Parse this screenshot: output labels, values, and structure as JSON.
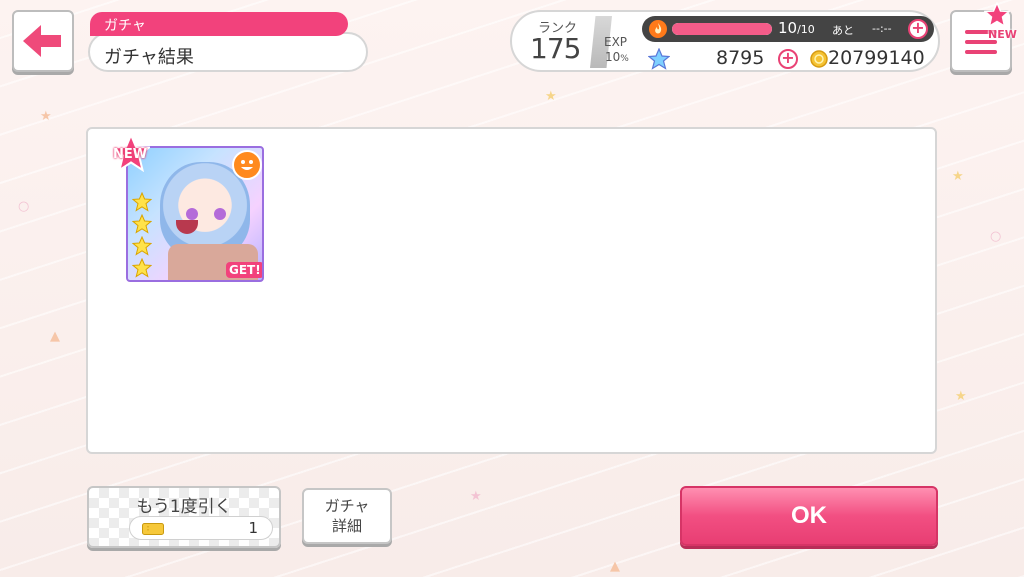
{
  "header": {
    "back_icon": "arrow-left-icon",
    "section_tab": "ガチャ",
    "page_title": "ガチャ結果"
  },
  "status": {
    "rank_label": "ランク",
    "rank_value": "175",
    "exp_label": "EXP",
    "exp_percent": "10",
    "exp_percent_unit": "%",
    "stamina_current": "10",
    "stamina_max": "/10",
    "stamina_refill_label": "あと",
    "stamina_timer": "--:--",
    "star_gems": "8795",
    "coins": "20799140"
  },
  "menu": {
    "menu_icon": "hamburger-menu-icon",
    "new_badge": "NEW"
  },
  "result": {
    "cards": [
      {
        "new_badge": "NEW",
        "get_badge": "GET!",
        "rarity_stars": 4,
        "attribute_icon": "happy-attribute-icon"
      }
    ]
  },
  "actions": {
    "draw_again_label": "もう1度引く",
    "ticket_count": "1",
    "gacha_detail_line1": "ガチャ",
    "gacha_detail_line2": "詳細",
    "ok_label": "OK"
  },
  "colors": {
    "accent_pink": "#f2427c",
    "ok_button": "#f24f82",
    "attribute_happy": "#ff8a1e"
  }
}
